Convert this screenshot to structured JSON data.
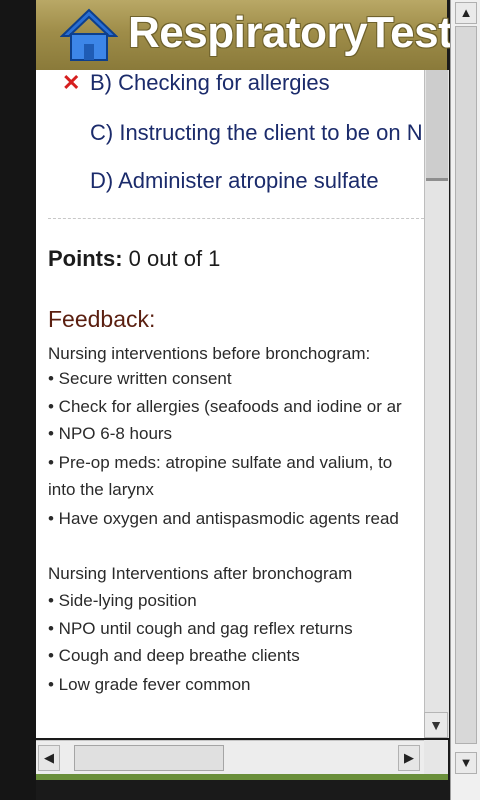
{
  "header": {
    "title": "RespiratoryTest",
    "home_icon": "home-icon"
  },
  "question": {
    "answers": [
      {
        "label": "B) Checking for allergies",
        "status": "wrong"
      },
      {
        "label": "C) Instructing the client to be on NPO",
        "status": "none"
      },
      {
        "label": "D) Administer atropine sulfate",
        "status": "none"
      }
    ]
  },
  "result": {
    "points_label": "Points:",
    "points_value": " 0 out of 1"
  },
  "feedback": {
    "title": "Feedback:",
    "lines": [
      "Nursing interventions before bronchogram:",
      "• Secure written consent",
      "• Check for allergies (seafoods and iodine or ar",
      "• NPO 6-8 hours",
      "• Pre-op meds: atropine sulfate and valium, to",
      "into the larynx",
      "• Have oxygen and antispasmodic agents read",
      "",
      "Nursing Interventions after bronchogram",
      "• Side-lying position",
      "• NPO until cough and gag reflex returns",
      "• Cough and deep breathe clients",
      "• Low grade fever common"
    ]
  },
  "colors": {
    "header_bg": "#a3924f",
    "wrong_mark": "#d61f1f",
    "answer_text": "#1b2b6b",
    "feedback_title": "#5a1f10"
  }
}
